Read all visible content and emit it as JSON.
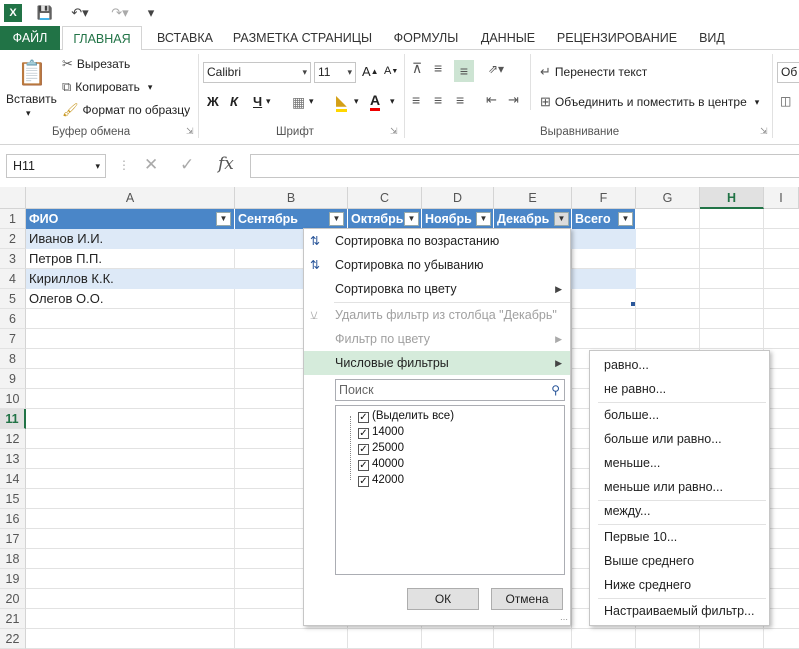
{
  "qat": {
    "excel_icon": "excel-icon",
    "save": "save-icon",
    "undo": "undo-icon",
    "redo": "redo-icon",
    "more": "customize-icon"
  },
  "tabs": [
    "ФАЙЛ",
    "ГЛАВНАЯ",
    "ВСТАВКА",
    "РАЗМЕТКА СТРАНИЦЫ",
    "ФОРМУЛЫ",
    "ДАННЫЕ",
    "РЕЦЕНЗИРОВАНИЕ",
    "ВИД"
  ],
  "clipboard": {
    "paste": "Вставить",
    "cut": "Вырезать",
    "copy": "Копировать",
    "format_painter": "Формат по образцу",
    "label": "Буфер обмена"
  },
  "font": {
    "name": "Calibri",
    "size": "11",
    "bold": "Ж",
    "italic": "К",
    "underline": "Ч",
    "label": "Шрифт"
  },
  "alignment": {
    "wrap": "Перенести текст",
    "merge": "Объединить и поместить в центре",
    "label": "Выравнивание"
  },
  "number": {
    "format": "Об"
  },
  "formula_bar": {
    "cell": "H11",
    "fx": "fx"
  },
  "columns": [
    "A",
    "B",
    "C",
    "D",
    "E",
    "F",
    "G",
    "H",
    "I"
  ],
  "rows": [
    "1",
    "2",
    "3",
    "4",
    "5",
    "6",
    "7",
    "8",
    "9",
    "10",
    "11",
    "12",
    "13",
    "14",
    "15",
    "16",
    "17",
    "18",
    "19",
    "20",
    "21",
    "22"
  ],
  "table": {
    "headers": [
      "ФИО",
      "Сентябрь",
      "Октябрь",
      "Ноябрь",
      "Декабрь",
      "Всего"
    ],
    "names": [
      "Иванов И.И.",
      "Петров П.П.",
      "Кириллов К.К.",
      "Олегов    О.О."
    ]
  },
  "menu": {
    "sort_asc": "Сортировка по возрастанию",
    "sort_desc": "Сортировка по убыванию",
    "sort_color": "Сортировка по цвету",
    "clear_filter": "Удалить фильтр из столбца \"Декабрь\"",
    "filter_color": "Фильтр по цвету",
    "number_filters": "Числовые фильтры",
    "search_placeholder": "Поиск",
    "items": [
      "(Выделить все)",
      "14000",
      "25000",
      "40000",
      "42000"
    ],
    "ok": "ОК",
    "cancel": "Отмена"
  },
  "submenu": [
    "равно...",
    "не равно...",
    "больше...",
    "больше или равно...",
    "меньше...",
    "меньше или равно...",
    "между...",
    "Первые 10...",
    "Выше среднего",
    "Ниже среднего",
    "Настраиваемый фильтр..."
  ],
  "colors": {
    "excel_green": "#217346",
    "table_header": "#4a86c8",
    "band": "#dde9f7",
    "highlight": "#d5ebdb"
  }
}
